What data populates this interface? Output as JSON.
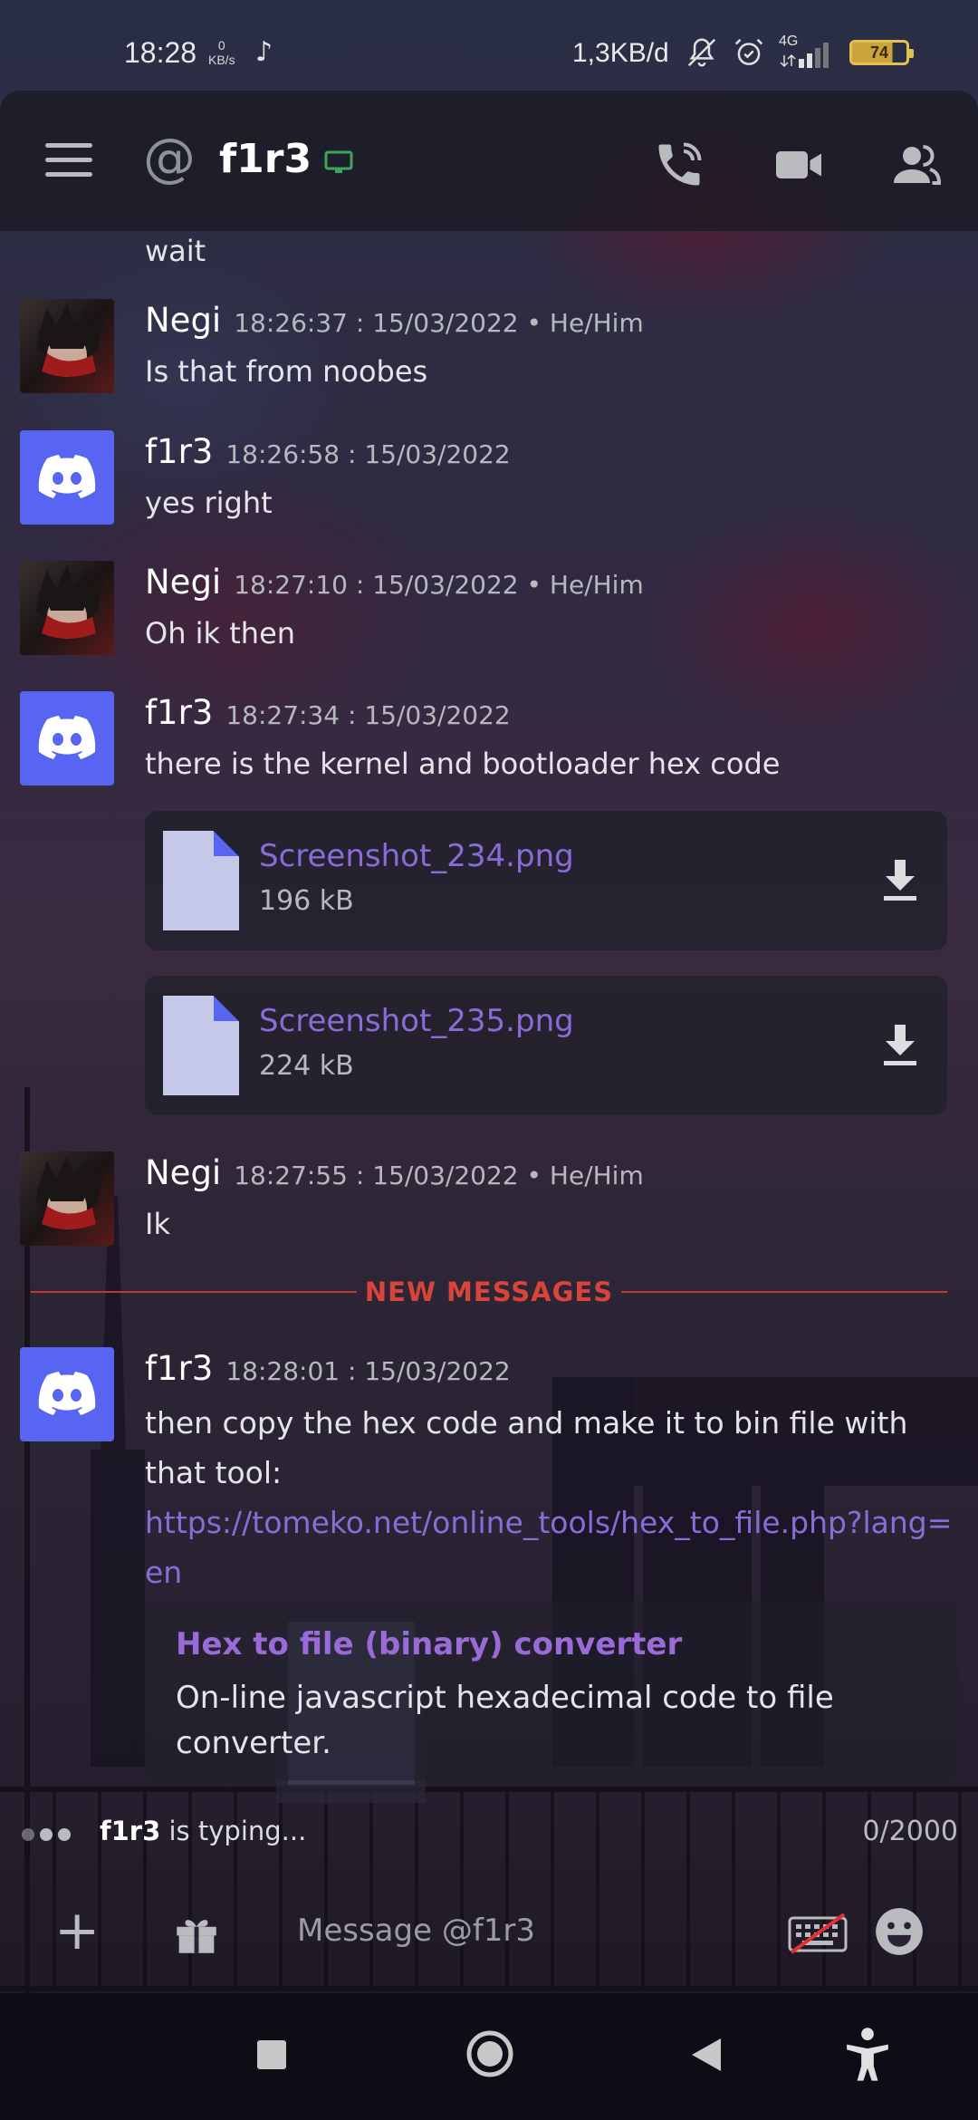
{
  "status_bar": {
    "time": "18:28",
    "net_speed_value": "0",
    "net_speed_unit": "KB/s",
    "data_rate": "1,3KB/d",
    "network_type": "4G",
    "battery_level": "74"
  },
  "header": {
    "at_symbol": "@",
    "channel_name": "f1r3"
  },
  "messages": {
    "partial": {
      "text": "wait"
    },
    "m1": {
      "author": "Negi",
      "timestamp": "18:26:37 : 15/03/2022 • He/Him",
      "text": "Is that from noobes"
    },
    "m2": {
      "author": "f1r3",
      "timestamp": "18:26:58 : 15/03/2022",
      "text": "yes right"
    },
    "m3": {
      "author": "Negi",
      "timestamp": "18:27:10 : 15/03/2022 • He/Him",
      "text": "Oh ik then"
    },
    "m4": {
      "author": "f1r3",
      "timestamp": "18:27:34 : 15/03/2022",
      "text": "there is the kernel and bootloader hex code"
    },
    "attachments": [
      {
        "name": "Screenshot_234.png",
        "size": "196 kB"
      },
      {
        "name": "Screenshot_235.png",
        "size": "224 kB"
      }
    ],
    "m5": {
      "author": "Negi",
      "timestamp": "18:27:55 : 15/03/2022 • He/Him",
      "text": "Ik"
    },
    "new_messages_label": "NEW MESSAGES",
    "m6": {
      "author": "f1r3",
      "timestamp": "18:28:01 : 15/03/2022",
      "text": "then copy the hex code and make it to bin file with that tool:",
      "link": "https://tomeko.net/online_tools/hex_to_file.php?lang=en"
    },
    "embed": {
      "title": "Hex to file (binary) converter",
      "description": "On-line javascript hexadecimal code to file converter."
    }
  },
  "typing": {
    "user": "f1r3",
    "suffix": " is typing...",
    "char_counter": "0/2000"
  },
  "composer": {
    "plus": "+",
    "placeholder": "Message @f1r3"
  },
  "colors": {
    "discord_blurple": "#5865f2",
    "link": "#8a6cd8",
    "new_messages": "#d9443a",
    "online_screen": "#3ba55d"
  },
  "icons": [
    "menu-icon",
    "desktop-status-icon",
    "voice-call-icon",
    "video-call-icon",
    "members-icon",
    "file-icon",
    "download-icon",
    "gift-icon",
    "keyboard-icon",
    "emoji-icon",
    "recent-apps-icon",
    "home-icon",
    "back-icon",
    "accessibility-icon"
  ]
}
